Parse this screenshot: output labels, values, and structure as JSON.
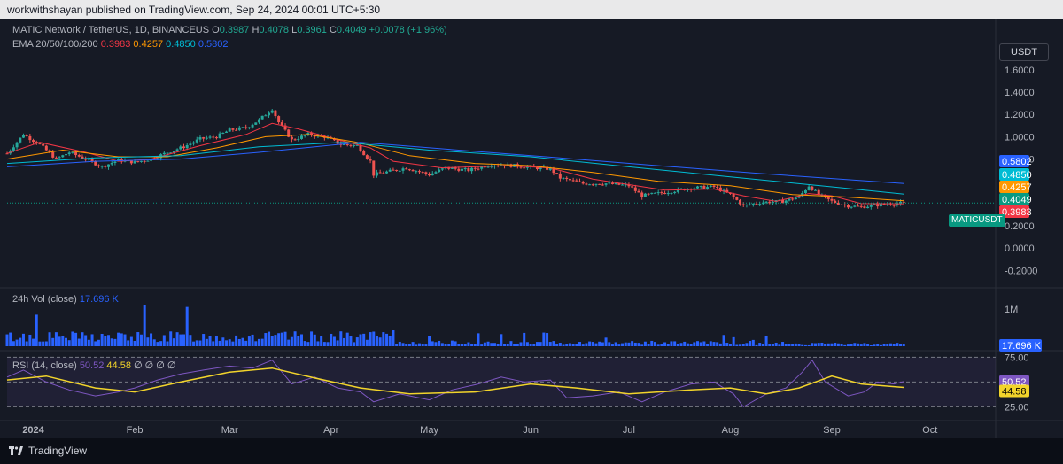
{
  "header": {
    "published": "workwithshayan published on TradingView.com, Sep 24, 2024 00:01 UTC+5:30"
  },
  "legend": {
    "symbol": "MATIC Network / TetherUS, 1D, BINANCEUS",
    "o_label": "O",
    "o": "0.3987",
    "h_label": "H",
    "h": "0.4078",
    "l_label": "L",
    "l": "0.3961",
    "c_label": "C",
    "c": "0.4049",
    "change": "+0.0078 (+1.96%)",
    "ema_label": "EMA 20/50/100/200",
    "ema20": "0.3983",
    "ema50": "0.4257",
    "ema100": "0.4850",
    "ema200": "0.5802",
    "vol_label": "24h Vol (close)",
    "vol_value": "17.696 K",
    "rsi_label": "RSI (14, close)",
    "rsi_value": "50.52",
    "rsi_ma": "44.58",
    "rsi_extra": "∅ ∅ ∅ ∅"
  },
  "currency_button": "USDT",
  "symbol_tag": "MATICUSDT",
  "brand": "TradingView",
  "colors": {
    "up": "#26a69a",
    "down": "#ef5350",
    "ema20": "#f23645",
    "ema50": "#ff9800",
    "ema100": "#00bcd4",
    "ema200": "#2962ff",
    "volume": "#2962ff",
    "rsi_line": "#7e57c2",
    "rsi_ma": "#f2d42b"
  },
  "chart_data": {
    "type": "candlestick",
    "title": "MATIC Network / TetherUS, 1D, BINANCEUS",
    "x_range": [
      "2023-12-24",
      "2024-10-20"
    ],
    "x_ticks": [
      "2024",
      "Feb",
      "Mar",
      "Apr",
      "May",
      "Jun",
      "Jul",
      "Aug",
      "Sep",
      "Oct"
    ],
    "x_tick_dates": [
      "2024-01-01",
      "2024-02-01",
      "2024-03-01",
      "2024-04-01",
      "2024-05-01",
      "2024-06-01",
      "2024-07-01",
      "2024-08-01",
      "2024-09-01",
      "2024-10-01"
    ],
    "price_axis": {
      "ticks": [
        "1.6000",
        "1.4000",
        "1.2000",
        "1.0000",
        "0.8000",
        "0.2000",
        "0.0000",
        "-0.2000"
      ],
      "ylim": [
        -0.3,
        1.75
      ]
    },
    "price_tags": [
      {
        "label": "0.5802",
        "value": 0.5802,
        "color": "#2962ff"
      },
      {
        "label": "0.4850",
        "value": 0.485,
        "color": "#00bcd4"
      },
      {
        "label": "0.4257",
        "value": 0.4257,
        "color": "#ff9800"
      },
      {
        "label": "0.4049",
        "value": 0.4049,
        "color": "#089981"
      },
      {
        "label": "0.3983",
        "value": 0.3983,
        "color": "#f23645"
      }
    ],
    "close_path": [
      [
        "2023-12-24",
        0.85
      ],
      [
        "2023-12-29",
        1.02
      ],
      [
        "2024-01-03",
        0.93
      ],
      [
        "2024-01-08",
        0.8
      ],
      [
        "2024-01-12",
        0.86
      ],
      [
        "2024-01-17",
        0.8
      ],
      [
        "2024-01-22",
        0.73
      ],
      [
        "2024-01-27",
        0.79
      ],
      [
        "2024-02-01",
        0.77
      ],
      [
        "2024-02-06",
        0.8
      ],
      [
        "2024-02-11",
        0.86
      ],
      [
        "2024-02-16",
        0.91
      ],
      [
        "2024-02-21",
        0.98
      ],
      [
        "2024-02-26",
        1.0
      ],
      [
        "2024-03-01",
        1.06
      ],
      [
        "2024-03-06",
        1.08
      ],
      [
        "2024-03-10",
        1.15
      ],
      [
        "2024-03-14",
        1.25
      ],
      [
        "2024-03-16",
        1.13
      ],
      [
        "2024-03-20",
        0.97
      ],
      [
        "2024-03-25",
        1.02
      ],
      [
        "2024-03-30",
        1.0
      ],
      [
        "2024-04-04",
        0.93
      ],
      [
        "2024-04-09",
        0.92
      ],
      [
        "2024-04-13",
        0.78
      ],
      [
        "2024-04-14",
        0.66
      ],
      [
        "2024-04-19",
        0.69
      ],
      [
        "2024-04-24",
        0.72
      ],
      [
        "2024-05-01",
        0.66
      ],
      [
        "2024-05-06",
        0.72
      ],
      [
        "2024-05-13",
        0.7
      ],
      [
        "2024-05-20",
        0.75
      ],
      [
        "2024-05-27",
        0.74
      ],
      [
        "2024-06-03",
        0.72
      ],
      [
        "2024-06-07",
        0.71
      ],
      [
        "2024-06-10",
        0.63
      ],
      [
        "2024-06-17",
        0.58
      ],
      [
        "2024-06-24",
        0.58
      ],
      [
        "2024-07-01",
        0.56
      ],
      [
        "2024-07-05",
        0.47
      ],
      [
        "2024-07-12",
        0.5
      ],
      [
        "2024-07-20",
        0.54
      ],
      [
        "2024-07-27",
        0.55
      ],
      [
        "2024-08-01",
        0.48
      ],
      [
        "2024-08-05",
        0.38
      ],
      [
        "2024-08-10",
        0.41
      ],
      [
        "2024-08-17",
        0.42
      ],
      [
        "2024-08-22",
        0.46
      ],
      [
        "2024-08-25",
        0.56
      ],
      [
        "2024-08-28",
        0.48
      ],
      [
        "2024-09-01",
        0.42
      ],
      [
        "2024-09-06",
        0.38
      ],
      [
        "2024-09-10",
        0.37
      ],
      [
        "2024-09-16",
        0.39
      ],
      [
        "2024-09-20",
        0.4
      ],
      [
        "2024-09-23",
        0.4049
      ]
    ],
    "ema": [
      {
        "name": "EMA 20",
        "value": 0.3983,
        "points": [
          [
            "2023-12-24",
            0.85
          ],
          [
            "2024-01-03",
            0.95
          ],
          [
            "2024-01-17",
            0.86
          ],
          [
            "2024-01-27",
            0.78
          ],
          [
            "2024-02-06",
            0.8
          ],
          [
            "2024-02-21",
            0.92
          ],
          [
            "2024-03-06",
            1.02
          ],
          [
            "2024-03-14",
            1.12
          ],
          [
            "2024-03-22",
            1.07
          ],
          [
            "2024-04-02",
            0.98
          ],
          [
            "2024-04-13",
            0.9
          ],
          [
            "2024-04-20",
            0.78
          ],
          [
            "2024-05-05",
            0.72
          ],
          [
            "2024-05-25",
            0.74
          ],
          [
            "2024-06-07",
            0.72
          ],
          [
            "2024-06-20",
            0.62
          ],
          [
            "2024-07-01",
            0.57
          ],
          [
            "2024-07-12",
            0.52
          ],
          [
            "2024-07-27",
            0.53
          ],
          [
            "2024-08-05",
            0.47
          ],
          [
            "2024-08-15",
            0.42
          ],
          [
            "2024-08-25",
            0.49
          ],
          [
            "2024-09-01",
            0.47
          ],
          [
            "2024-09-10",
            0.4
          ],
          [
            "2024-09-23",
            0.3983
          ]
        ]
      },
      {
        "name": "EMA 50",
        "value": 0.4257,
        "points": [
          [
            "2023-12-24",
            0.8
          ],
          [
            "2024-01-10",
            0.88
          ],
          [
            "2024-01-27",
            0.82
          ],
          [
            "2024-02-11",
            0.82
          ],
          [
            "2024-02-26",
            0.9
          ],
          [
            "2024-03-12",
            1.0
          ],
          [
            "2024-03-25",
            1.02
          ],
          [
            "2024-04-09",
            0.95
          ],
          [
            "2024-04-25",
            0.83
          ],
          [
            "2024-05-15",
            0.76
          ],
          [
            "2024-06-01",
            0.74
          ],
          [
            "2024-06-20",
            0.68
          ],
          [
            "2024-07-10",
            0.6
          ],
          [
            "2024-08-01",
            0.56
          ],
          [
            "2024-08-20",
            0.48
          ],
          [
            "2024-09-05",
            0.46
          ],
          [
            "2024-09-23",
            0.4257
          ]
        ]
      },
      {
        "name": "EMA 100",
        "value": 0.485,
        "points": [
          [
            "2023-12-24",
            0.76
          ],
          [
            "2024-01-20",
            0.81
          ],
          [
            "2024-02-15",
            0.83
          ],
          [
            "2024-03-10",
            0.91
          ],
          [
            "2024-04-05",
            0.95
          ],
          [
            "2024-05-01",
            0.88
          ],
          [
            "2024-06-01",
            0.82
          ],
          [
            "2024-07-01",
            0.73
          ],
          [
            "2024-08-01",
            0.64
          ],
          [
            "2024-09-01",
            0.55
          ],
          [
            "2024-09-23",
            0.485
          ]
        ]
      },
      {
        "name": "EMA 200",
        "value": 0.5802,
        "points": [
          [
            "2023-12-24",
            0.73
          ],
          [
            "2024-01-20",
            0.78
          ],
          [
            "2024-02-15",
            0.8
          ],
          [
            "2024-03-10",
            0.86
          ],
          [
            "2024-04-10",
            0.95
          ],
          [
            "2024-05-10",
            0.88
          ],
          [
            "2024-06-10",
            0.81
          ],
          [
            "2024-07-10",
            0.74
          ],
          [
            "2024-08-10",
            0.67
          ],
          [
            "2024-09-23",
            0.5802
          ]
        ]
      }
    ],
    "volume": {
      "ylim": [
        0,
        1400000
      ],
      "tick": "1M",
      "tick_value": 1000000,
      "last": 17696,
      "last_label": "17.696 K"
    },
    "rsi": {
      "ylim": [
        20,
        78
      ],
      "upper": 75,
      "lower": 25,
      "mid": 50,
      "upper_label": "75.00",
      "lower_label": "25.00",
      "value": 50.52,
      "ma_value": 44.58,
      "line": [
        [
          "2023-12-24",
          55
        ],
        [
          "2023-12-29",
          62
        ],
        [
          "2024-01-05",
          50
        ],
        [
          "2024-01-12",
          42
        ],
        [
          "2024-01-20",
          36
        ],
        [
          "2024-01-27",
          40
        ],
        [
          "2024-02-01",
          44
        ],
        [
          "2024-02-08",
          52
        ],
        [
          "2024-02-15",
          58
        ],
        [
          "2024-02-22",
          62
        ],
        [
          "2024-03-01",
          66
        ],
        [
          "2024-03-08",
          64
        ],
        [
          "2024-03-14",
          72
        ],
        [
          "2024-03-20",
          48
        ],
        [
          "2024-03-27",
          55
        ],
        [
          "2024-04-03",
          44
        ],
        [
          "2024-04-10",
          40
        ],
        [
          "2024-04-14",
          30
        ],
        [
          "2024-04-22",
          38
        ],
        [
          "2024-05-01",
          32
        ],
        [
          "2024-05-08",
          42
        ],
        [
          "2024-05-16",
          48
        ],
        [
          "2024-05-23",
          55
        ],
        [
          "2024-05-30",
          50
        ],
        [
          "2024-06-07",
          52
        ],
        [
          "2024-06-12",
          34
        ],
        [
          "2024-06-20",
          36
        ],
        [
          "2024-06-28",
          40
        ],
        [
          "2024-07-05",
          30
        ],
        [
          "2024-07-12",
          40
        ],
        [
          "2024-07-20",
          48
        ],
        [
          "2024-07-27",
          50
        ],
        [
          "2024-08-02",
          38
        ],
        [
          "2024-08-05",
          25
        ],
        [
          "2024-08-12",
          38
        ],
        [
          "2024-08-18",
          44
        ],
        [
          "2024-08-23",
          60
        ],
        [
          "2024-08-26",
          72
        ],
        [
          "2024-08-30",
          50
        ],
        [
          "2024-09-06",
          36
        ],
        [
          "2024-09-11",
          40
        ],
        [
          "2024-09-15",
          50
        ],
        [
          "2024-09-20",
          48
        ],
        [
          "2024-09-23",
          50.52
        ]
      ],
      "ma": [
        [
          "2023-12-24",
          52
        ],
        [
          "2024-01-05",
          56
        ],
        [
          "2024-01-20",
          44
        ],
        [
          "2024-02-01",
          40
        ],
        [
          "2024-02-15",
          50
        ],
        [
          "2024-03-01",
          60
        ],
        [
          "2024-03-14",
          64
        ],
        [
          "2024-03-27",
          54
        ],
        [
          "2024-04-10",
          44
        ],
        [
          "2024-04-25",
          38
        ],
        [
          "2024-05-15",
          40
        ],
        [
          "2024-06-01",
          48
        ],
        [
          "2024-06-15",
          44
        ],
        [
          "2024-07-01",
          38
        ],
        [
          "2024-07-20",
          42
        ],
        [
          "2024-08-01",
          44
        ],
        [
          "2024-08-12",
          38
        ],
        [
          "2024-08-22",
          44
        ],
        [
          "2024-09-01",
          56
        ],
        [
          "2024-09-10",
          48
        ],
        [
          "2024-09-23",
          44.58
        ]
      ]
    }
  }
}
